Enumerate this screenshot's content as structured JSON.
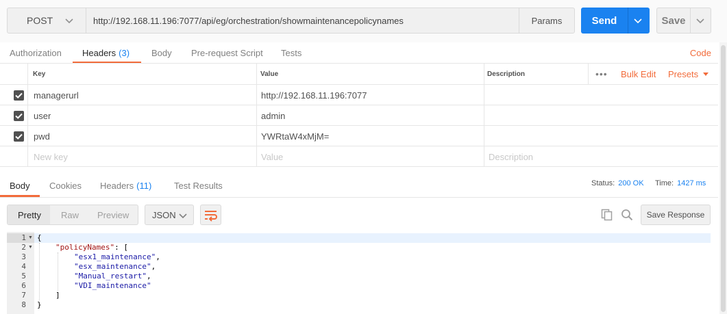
{
  "request": {
    "method": "POST",
    "url": "http://192.168.11.196:7077/api/eg/orchestration/showmaintenancepolicynames",
    "params_label": "Params",
    "send_label": "Send",
    "save_label": "Save"
  },
  "request_tabs": {
    "authorization": "Authorization",
    "headers": "Headers",
    "headers_count": "(3)",
    "body": "Body",
    "pre_request": "Pre-request Script",
    "tests": "Tests",
    "code": "Code"
  },
  "headers_table": {
    "col_key": "Key",
    "col_value": "Value",
    "col_description": "Description",
    "bulk_edit": "Bulk Edit",
    "presets": "Presets",
    "rows": [
      {
        "key": "managerurl",
        "value": "http://192.168.11.196:7077",
        "checked": true
      },
      {
        "key": "user",
        "value": "admin",
        "checked": true
      },
      {
        "key": "pwd",
        "value": "YWRtaW4xMjM=",
        "checked": true
      }
    ],
    "new_key_placeholder": "New key",
    "value_placeholder": "Value",
    "description_placeholder": "Description"
  },
  "response_tabs": {
    "body": "Body",
    "cookies": "Cookies",
    "headers": "Headers",
    "headers_count": "(11)",
    "test_results": "Test Results"
  },
  "response_meta": {
    "status_label": "Status:",
    "status_value": "200 OK",
    "time_label": "Time:",
    "time_value": "1427 ms"
  },
  "response_toolbar": {
    "pretty": "Pretty",
    "raw": "Raw",
    "preview": "Preview",
    "format": "JSON",
    "save_response": "Save Response"
  },
  "response_body": {
    "line_numbers": [
      "1",
      "2",
      "3",
      "4",
      "5",
      "6",
      "7",
      "8"
    ],
    "open_brace": "{",
    "key_policy": "\"policyNames\"",
    "colon_bracket": ": [",
    "items": [
      "\"esx1_maintenance\"",
      "\"esx_maintenance\"",
      "\"Manual_restart\"",
      "\"VDI_maintenance\""
    ],
    "comma": ",",
    "close_bracket": "]",
    "close_brace": "}"
  },
  "colors": {
    "accent": "#f26b3a",
    "primary": "#1a82f0"
  }
}
